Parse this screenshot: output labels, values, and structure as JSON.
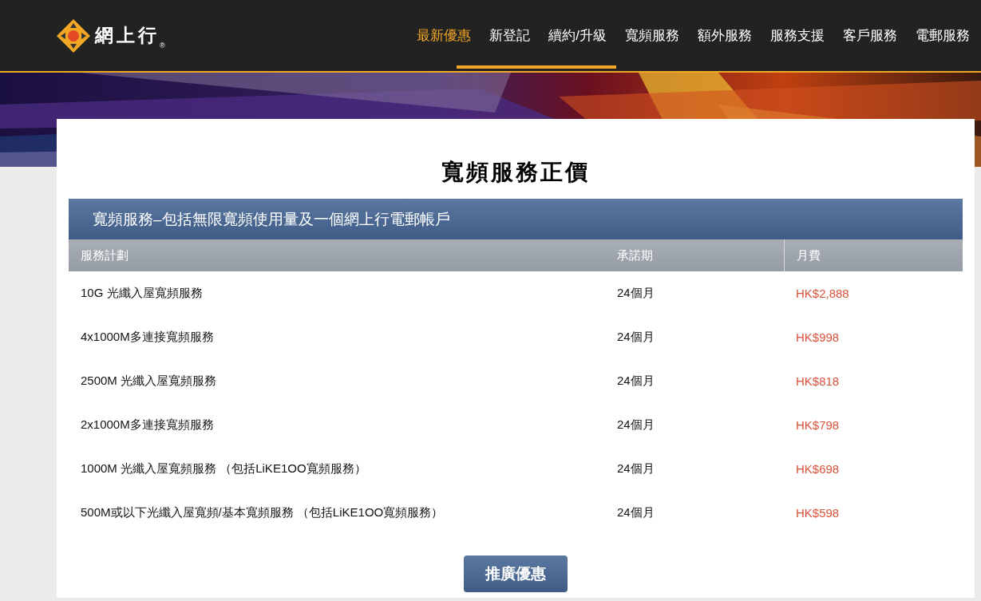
{
  "logo": {
    "text": "網上行",
    "mark": "®"
  },
  "nav": [
    {
      "label": "最新優惠",
      "selected": true
    },
    {
      "label": "新登記",
      "selected": false
    },
    {
      "label": "續約/升級",
      "selected": false
    },
    {
      "label": "寬頻服務",
      "selected": false
    },
    {
      "label": "額外服務",
      "selected": false
    },
    {
      "label": "服務支援",
      "selected": false
    },
    {
      "label": "客戶服務",
      "selected": false
    },
    {
      "label": "電郵服務",
      "selected": false
    }
  ],
  "page_title": "寬頻服務正價",
  "table": {
    "caption": "寬頻服務–包括無限寬頻使用量及一個網上行電郵帳戶",
    "columns": [
      "服務計劃",
      "承諾期",
      "月費"
    ],
    "rows": [
      {
        "plan": "10G 光纖入屋寬頻服務",
        "period": "24個月",
        "fee": "HK$2,888"
      },
      {
        "plan": "4x1000M多連接寬頻服務",
        "period": "24個月",
        "fee": "HK$998"
      },
      {
        "plan": "2500M 光纖入屋寬頻服務",
        "period": "24個月",
        "fee": "HK$818"
      },
      {
        "plan": "2x1000M多連接寬頻服務",
        "period": "24個月",
        "fee": "HK$798"
      },
      {
        "plan": "1000M 光纖入屋寬頻服務 （包括LiKE1OO寬頻服務）",
        "period": "24個月",
        "fee": "HK$698"
      },
      {
        "plan": "500M或以下光纖入屋寬頻/基本寬頻服務 （包括LiKE1OO寬頻服務）",
        "period": "24個月",
        "fee": "HK$598"
      }
    ]
  },
  "promo_button": "推廣優惠"
}
